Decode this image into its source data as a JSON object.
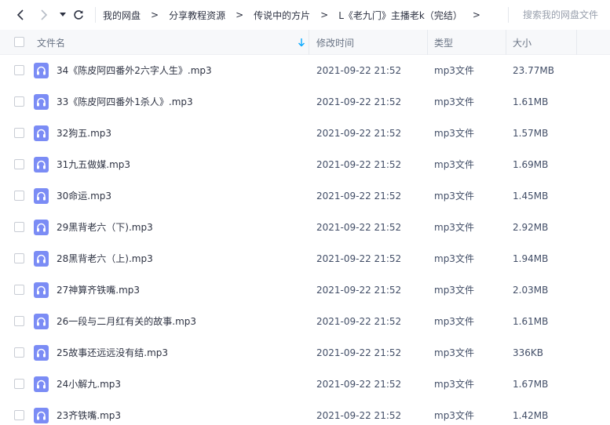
{
  "nav": {
    "back_icon": "chevron-left-icon",
    "forward_icon": "chevron-right-icon",
    "history_icon": "caret-down-icon",
    "refresh_icon": "refresh-icon"
  },
  "breadcrumb": {
    "items": [
      "我的网盘",
      "分享教程资源",
      "传说中的方片",
      "L《老九门》主播老k（完结）"
    ],
    "separator": ">"
  },
  "search": {
    "placeholder": "搜索我的网盘文件"
  },
  "table": {
    "headers": {
      "name": "文件名",
      "modified": "修改时间",
      "type": "类型",
      "size": "大小"
    },
    "sort_icon": "sort-down-arrow-icon",
    "file_icon": "audio-file-icon",
    "rows": [
      {
        "name": "34《陈皮阿四番外2六字人生》.mp3",
        "modified": "2021-09-22 21:52",
        "type": "mp3文件",
        "size": "23.77MB"
      },
      {
        "name": "33《陈皮阿四番外1杀人》.mp3",
        "modified": "2021-09-22 21:52",
        "type": "mp3文件",
        "size": "1.61MB"
      },
      {
        "name": "32狗五.mp3",
        "modified": "2021-09-22 21:52",
        "type": "mp3文件",
        "size": "1.57MB"
      },
      {
        "name": "31九五做媒.mp3",
        "modified": "2021-09-22 21:52",
        "type": "mp3文件",
        "size": "1.69MB"
      },
      {
        "name": "30命运.mp3",
        "modified": "2021-09-22 21:52",
        "type": "mp3文件",
        "size": "1.45MB"
      },
      {
        "name": "29黑背老六（下).mp3",
        "modified": "2021-09-22 21:52",
        "type": "mp3文件",
        "size": "2.92MB"
      },
      {
        "name": "28黑背老六（上).mp3",
        "modified": "2021-09-22 21:52",
        "type": "mp3文件",
        "size": "1.94MB"
      },
      {
        "name": "27神算齐铁嘴.mp3",
        "modified": "2021-09-22 21:52",
        "type": "mp3文件",
        "size": "2.03MB"
      },
      {
        "name": "26一段与二月红有关的故事.mp3",
        "modified": "2021-09-22 21:52",
        "type": "mp3文件",
        "size": "1.61MB"
      },
      {
        "name": "25故事还远远没有结.mp3",
        "modified": "2021-09-22 21:52",
        "type": "mp3文件",
        "size": "336KB"
      },
      {
        "name": "24小解九.mp3",
        "modified": "2021-09-22 21:52",
        "type": "mp3文件",
        "size": "1.67MB"
      },
      {
        "name": "23齐铁嘴.mp3",
        "modified": "2021-09-22 21:52",
        "type": "mp3文件",
        "size": "1.42MB"
      }
    ]
  },
  "colors": {
    "accent": "#06a7ff",
    "file_icon_bg": "#7b8cf5",
    "text_primary": "#2d3242",
    "header_bg": "#f7f8fa"
  }
}
